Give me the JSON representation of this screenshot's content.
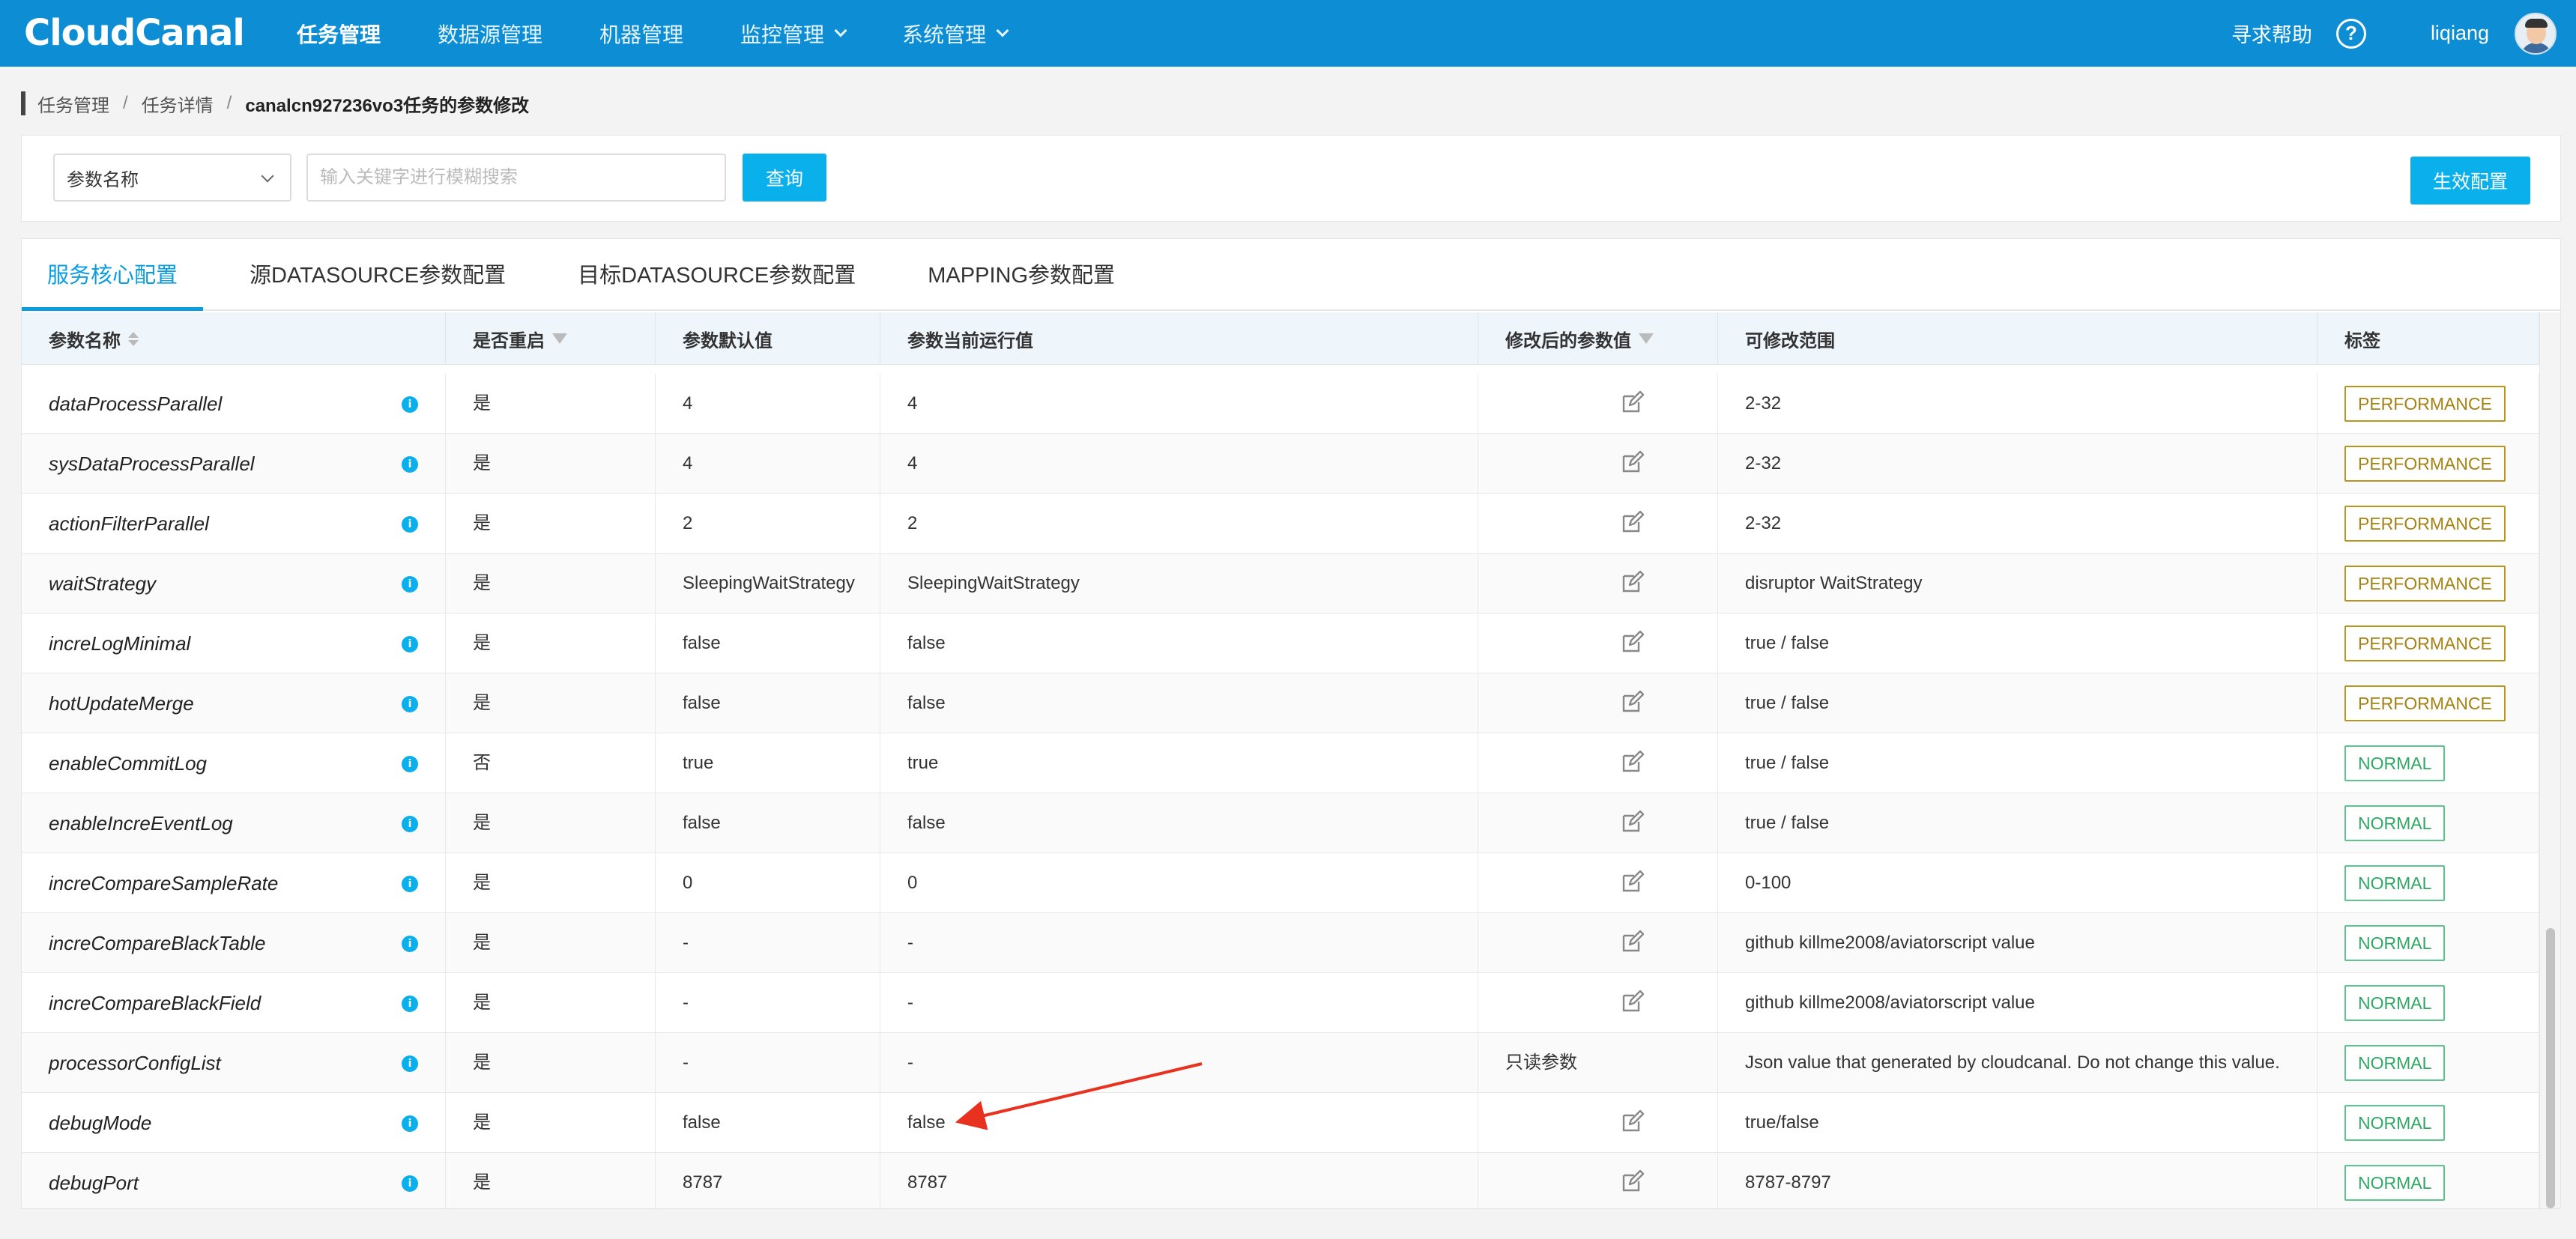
{
  "header": {
    "logo": "CloudCanal",
    "nav": [
      {
        "label": "任务管理",
        "active": true,
        "dropdown": false
      },
      {
        "label": "数据源管理",
        "active": false,
        "dropdown": false
      },
      {
        "label": "机器管理",
        "active": false,
        "dropdown": false
      },
      {
        "label": "监控管理",
        "active": false,
        "dropdown": true
      },
      {
        "label": "系统管理",
        "active": false,
        "dropdown": true
      }
    ],
    "help_label": "寻求帮助",
    "help_icon": "?",
    "username": "liqiang"
  },
  "breadcrumb": {
    "items": [
      "任务管理",
      "任务详情"
    ],
    "current": "canalcn927236vo3任务的参数修改",
    "separator": "/"
  },
  "search": {
    "select_value": "参数名称",
    "placeholder": "输入关键字进行模糊搜索",
    "query_label": "查询",
    "apply_label": "生效配置"
  },
  "tabs": [
    {
      "label": "服务核心配置",
      "active": true
    },
    {
      "label": "源DATASOURCE参数配置",
      "active": false
    },
    {
      "label": "目标DATASOURCE参数配置",
      "active": false
    },
    {
      "label": "MAPPING参数配置",
      "active": false
    }
  ],
  "table": {
    "columns": [
      "参数名称",
      "是否重启",
      "参数默认值",
      "参数当前运行值",
      "修改后的参数值",
      "可修改范围",
      "标签"
    ],
    "rows": [
      {
        "name": "dataProcessParallel",
        "restart": "是",
        "default": "4",
        "current": "4",
        "modified": "",
        "range": "2-32",
        "tag": "PERFORMANCE"
      },
      {
        "name": "sysDataProcessParallel",
        "restart": "是",
        "default": "4",
        "current": "4",
        "modified": "",
        "range": "2-32",
        "tag": "PERFORMANCE"
      },
      {
        "name": "actionFilterParallel",
        "restart": "是",
        "default": "2",
        "current": "2",
        "modified": "",
        "range": "2-32",
        "tag": "PERFORMANCE"
      },
      {
        "name": "waitStrategy",
        "restart": "是",
        "default": "SleepingWaitStrategy",
        "current": "SleepingWaitStrategy",
        "modified": "",
        "range": "disruptor WaitStrategy",
        "tag": "PERFORMANCE"
      },
      {
        "name": "increLogMinimal",
        "restart": "是",
        "default": "false",
        "current": "false",
        "modified": "",
        "range": "true / false",
        "tag": "PERFORMANCE"
      },
      {
        "name": "hotUpdateMerge",
        "restart": "是",
        "default": "false",
        "current": "false",
        "modified": "",
        "range": "true / false",
        "tag": "PERFORMANCE"
      },
      {
        "name": "enableCommitLog",
        "restart": "否",
        "default": "true",
        "current": "true",
        "modified": "",
        "range": "true / false",
        "tag": "NORMAL"
      },
      {
        "name": "enableIncreEventLog",
        "restart": "是",
        "default": "false",
        "current": "false",
        "modified": "",
        "range": "true / false",
        "tag": "NORMAL"
      },
      {
        "name": "increCompareSampleRate",
        "restart": "是",
        "default": "0",
        "current": "0",
        "modified": "",
        "range": "0-100",
        "tag": "NORMAL"
      },
      {
        "name": "increCompareBlackTable",
        "restart": "是",
        "default": "-",
        "current": "-",
        "modified": "",
        "range": "github killme2008/aviatorscript value",
        "tag": "NORMAL"
      },
      {
        "name": "increCompareBlackField",
        "restart": "是",
        "default": "-",
        "current": "-",
        "modified": "",
        "range": "github killme2008/aviatorscript value",
        "tag": "NORMAL"
      },
      {
        "name": "processorConfigList",
        "restart": "是",
        "default": "-",
        "current": "-",
        "modified": "只读参数",
        "range": "Json value that generated by cloudcanal. Do not change this value.",
        "tag": "NORMAL"
      },
      {
        "name": "debugMode",
        "restart": "是",
        "default": "false",
        "current": "false",
        "modified": "",
        "range": "true/false",
        "tag": "NORMAL"
      },
      {
        "name": "debugPort",
        "restart": "是",
        "default": "8787",
        "current": "8787",
        "modified": "",
        "range": "8787-8797",
        "tag": "NORMAL"
      }
    ]
  },
  "icons": {
    "info": "info-icon",
    "edit": "edit-icon",
    "sort": "sort-icon",
    "filter": "filter-icon"
  },
  "colors": {
    "header_bg": "#0d8ed4",
    "accent": "#0ab0ec",
    "tag_performance": "#a38212",
    "tag_normal": "#2ea863",
    "annotation_arrow": "#e8311f"
  }
}
